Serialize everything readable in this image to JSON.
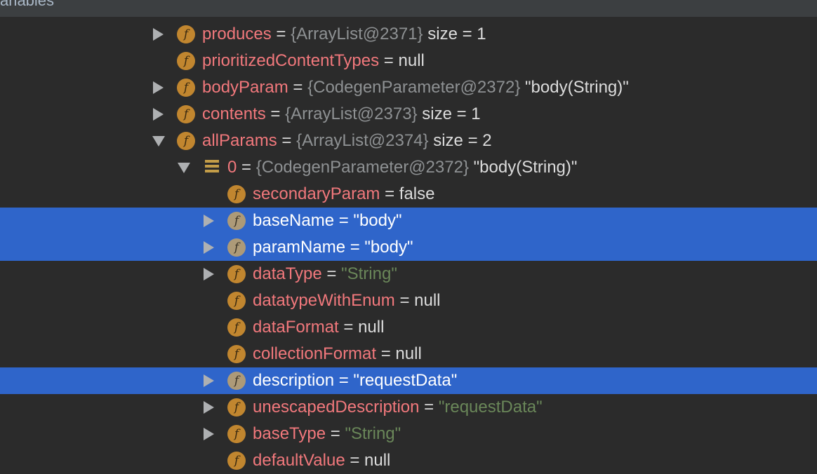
{
  "panel": {
    "title": "ariables"
  },
  "rows": [
    {
      "name": "produces",
      "eq": " = ",
      "ref": "{ArrayList@2371}",
      "value": "  size = 1",
      "value_type": "plain",
      "toggle": "collapsed",
      "icon": "field-icon",
      "selected": false
    },
    {
      "name": "prioritizedContentTypes",
      "eq": " = ",
      "ref": "",
      "value": "null",
      "value_type": "plain",
      "toggle": "none",
      "icon": "field-icon",
      "selected": false
    },
    {
      "name": "bodyParam",
      "eq": " = ",
      "ref": "{CodegenParameter@2372}",
      "value": " \"body(String)\"",
      "value_type": "plain",
      "toggle": "collapsed",
      "icon": "field-icon",
      "selected": false
    },
    {
      "name": "contents",
      "eq": " = ",
      "ref": "{ArrayList@2373}",
      "value": "  size = 1",
      "value_type": "plain",
      "toggle": "collapsed",
      "icon": "field-icon",
      "selected": false
    },
    {
      "name": "allParams",
      "eq": " = ",
      "ref": "{ArrayList@2374}",
      "value": "  size = 2",
      "value_type": "plain",
      "toggle": "expanded",
      "icon": "field-icon",
      "selected": false
    },
    {
      "name": "0",
      "eq": " = ",
      "ref": "{CodegenParameter@2372}",
      "value": " \"body(String)\"",
      "value_type": "plain",
      "toggle": "expanded",
      "icon": "array-element-icon",
      "selected": false
    },
    {
      "name": "secondaryParam",
      "eq": " = ",
      "ref": "",
      "value": "false",
      "value_type": "plain",
      "toggle": "none",
      "icon": "field-icon",
      "selected": false
    },
    {
      "name": "baseName",
      "eq": " = ",
      "ref": "",
      "value": "\"body\"",
      "value_type": "string",
      "toggle": "collapsed",
      "icon": "field-icon",
      "selected": true
    },
    {
      "name": "paramName",
      "eq": " = ",
      "ref": "",
      "value": "\"body\"",
      "value_type": "string",
      "toggle": "collapsed",
      "icon": "field-icon",
      "selected": true
    },
    {
      "name": "dataType",
      "eq": " = ",
      "ref": "",
      "value": "\"String\"",
      "value_type": "string",
      "toggle": "collapsed",
      "icon": "field-icon",
      "selected": false
    },
    {
      "name": "datatypeWithEnum",
      "eq": " = ",
      "ref": "",
      "value": "null",
      "value_type": "plain",
      "toggle": "none",
      "icon": "field-icon",
      "selected": false
    },
    {
      "name": "dataFormat",
      "eq": " = ",
      "ref": "",
      "value": "null",
      "value_type": "plain",
      "toggle": "none",
      "icon": "field-icon",
      "selected": false
    },
    {
      "name": "collectionFormat",
      "eq": " = ",
      "ref": "",
      "value": "null",
      "value_type": "plain",
      "toggle": "none",
      "icon": "field-icon",
      "selected": false
    },
    {
      "name": "description",
      "eq": " = ",
      "ref": "",
      "value": "\"requestData\"",
      "value_type": "string",
      "toggle": "collapsed",
      "icon": "field-icon",
      "selected": true
    },
    {
      "name": "unescapedDescription",
      "eq": " = ",
      "ref": "",
      "value": "\"requestData\"",
      "value_type": "string",
      "toggle": "collapsed",
      "icon": "field-icon",
      "selected": false
    },
    {
      "name": "baseType",
      "eq": " = ",
      "ref": "",
      "value": "\"String\"",
      "value_type": "string",
      "toggle": "collapsed",
      "icon": "field-icon",
      "selected": false
    },
    {
      "name": "defaultValue",
      "eq": " = ",
      "ref": "",
      "value": "null",
      "value_type": "plain",
      "toggle": "none",
      "icon": "field-icon",
      "selected": false
    }
  ]
}
